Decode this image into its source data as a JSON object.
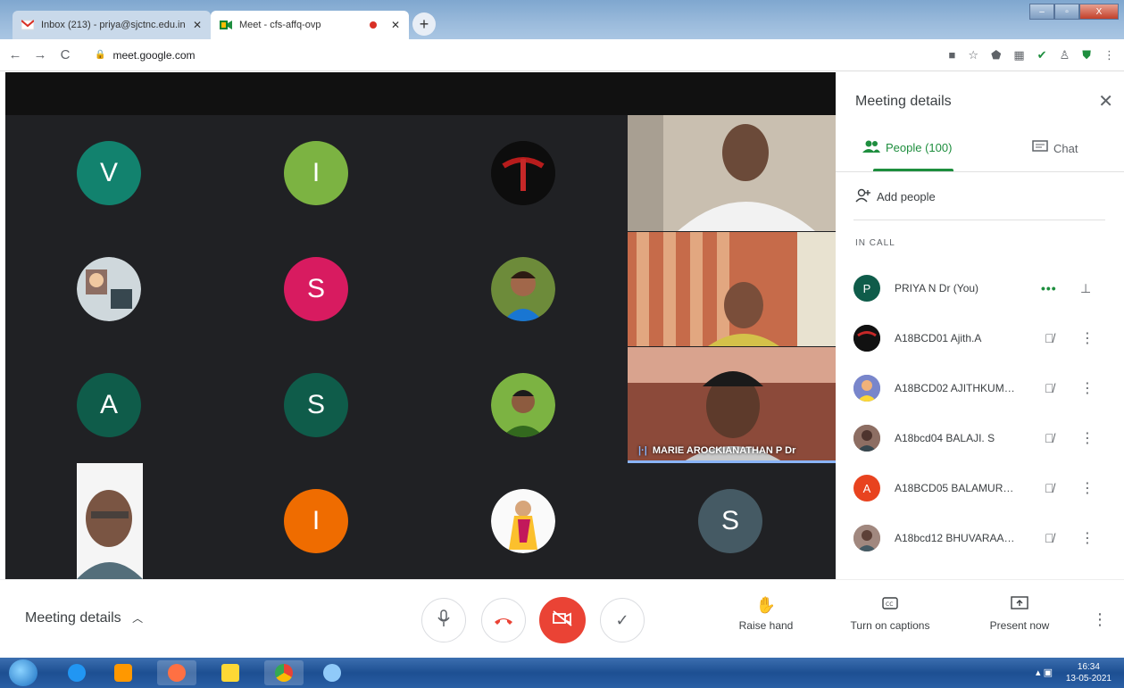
{
  "browser": {
    "tabs": [
      {
        "title": "Inbox (213) - priya@sjctnc.edu.in",
        "close": "✕"
      },
      {
        "title": "Meet - cfs-affq-ovp",
        "close": "✕"
      }
    ],
    "new_tab": "+",
    "url": "meet.google.com",
    "nav": {
      "back": "←",
      "forward": "→",
      "reload": "C"
    },
    "window_buttons": {
      "minimize": "–",
      "maximize": "▫",
      "close": "X"
    }
  },
  "stage": {
    "tiles": [
      {
        "initial": "V",
        "color": "#12826e"
      },
      {
        "initial": "I",
        "color": "#7cb342"
      },
      {
        "initial": "",
        "color": "#111111"
      },
      {
        "initial": "",
        "color": "#cfd8dc"
      },
      {
        "initial": "S",
        "color": "#d81b60"
      },
      {
        "initial": "",
        "color": "#5d4037"
      },
      {
        "initial": "A",
        "color": "#0f5c4a"
      },
      {
        "initial": "S",
        "color": "#0f5c4a"
      },
      {
        "initial": "",
        "color": "#558b2f"
      },
      {
        "initial": "",
        "color": "#9e9e9e"
      },
      {
        "initial": "I",
        "color": "#ef6c00"
      },
      {
        "initial": "",
        "color": "#f5f5f5"
      },
      {
        "initial": "S",
        "color": "#455a64"
      }
    ],
    "active_speaker": "MARIE AROCKIANATHAN P Dr"
  },
  "panel": {
    "title": "Meeting details",
    "close": "✕",
    "tab_people": "People (100)",
    "tab_chat": "Chat",
    "add_people": "Add people",
    "in_call": "IN CALL",
    "participants": [
      {
        "name": "PRIYA N Dr (You)",
        "initial": "P",
        "color": "#0f5c4a"
      },
      {
        "name": "A18BCD01 Ajith.A",
        "initial": "",
        "color": "#1a1a1a"
      },
      {
        "name": "A18BCD02 AJITHKUMA...",
        "initial": "",
        "color": "#5c6bc0"
      },
      {
        "name": "A18bcd04 BALAJI. S",
        "initial": "",
        "color": "#6d4c41"
      },
      {
        "name": "A18BCD05 BALAMURU...",
        "initial": "A",
        "color": "#e8431f"
      },
      {
        "name": "A18bcd12 BHUVARAAG...",
        "initial": "",
        "color": "#8d6e63"
      }
    ]
  },
  "controls": {
    "meeting_details": "Meeting details",
    "raise_hand": "Raise hand",
    "captions": "Turn on captions",
    "present": "Present now"
  },
  "taskbar": {
    "time": "16:34",
    "date": "13-05-2021"
  }
}
